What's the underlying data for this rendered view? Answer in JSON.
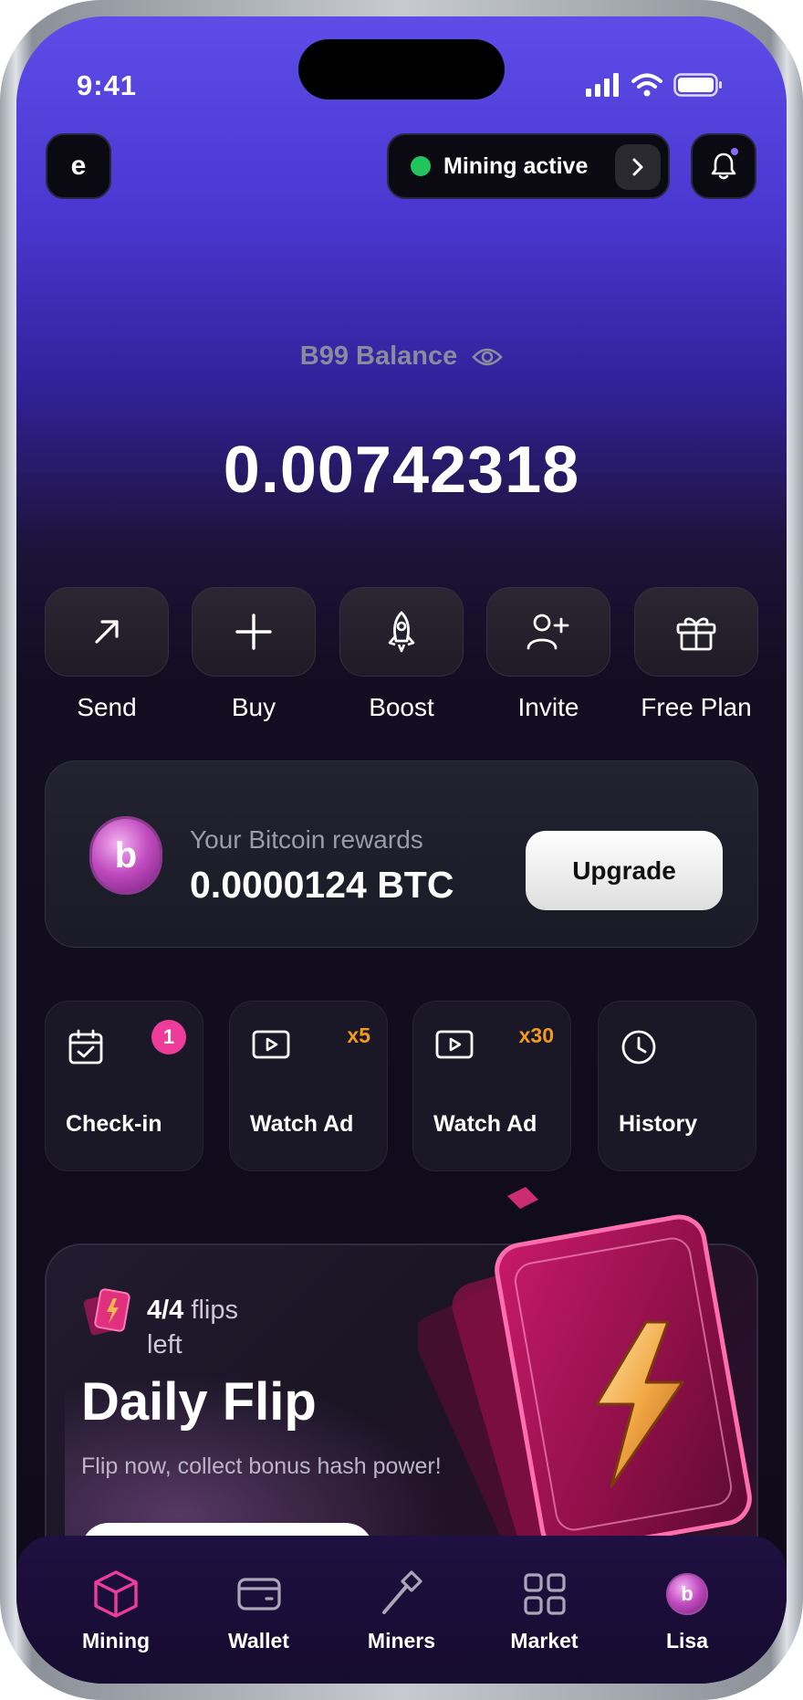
{
  "status_bar": {
    "time": "9:41"
  },
  "header": {
    "logo_letter": "e",
    "mining_status": "Mining active",
    "status_color": "#21c45d"
  },
  "balance": {
    "label": "B99 Balance",
    "value": "0.00742318"
  },
  "actions": [
    {
      "label": "Send",
      "icon": "arrow-up-right-icon"
    },
    {
      "label": "Buy",
      "icon": "plus-icon"
    },
    {
      "label": "Boost",
      "icon": "rocket-icon"
    },
    {
      "label": "Invite",
      "icon": "user-plus-icon"
    },
    {
      "label": "Free Plan",
      "icon": "gift-icon"
    }
  ],
  "rewards": {
    "coin_letter": "b",
    "label": "Your Bitcoin rewards",
    "value": "0.0000124 BTC",
    "button": "Upgrade"
  },
  "tasks": [
    {
      "label": "Check-in",
      "icon": "calendar-check-icon",
      "badge": "1"
    },
    {
      "label": "Watch Ad",
      "icon": "play-icon",
      "multiplier": "x5"
    },
    {
      "label": "Watch Ad",
      "icon": "play-icon",
      "multiplier": "x30"
    },
    {
      "label": "History",
      "icon": "clock-icon"
    }
  ],
  "daily_flip": {
    "count": "4/4",
    "count_suffix": "flips",
    "count_suffix2": "left",
    "title": "Daily Flip",
    "subtitle": "Flip now, collect bonus hash power!"
  },
  "nav": [
    {
      "label": "Mining",
      "icon": "cube-icon",
      "active": true
    },
    {
      "label": "Wallet",
      "icon": "wallet-icon"
    },
    {
      "label": "Miners",
      "icon": "hammer-icon"
    },
    {
      "label": "Market",
      "icon": "grid-icon"
    },
    {
      "label": "Lisa",
      "icon": "avatar"
    }
  ],
  "colors": {
    "accent_pink": "#ee3c9a",
    "multiplier_orange": "#f29a1d"
  }
}
